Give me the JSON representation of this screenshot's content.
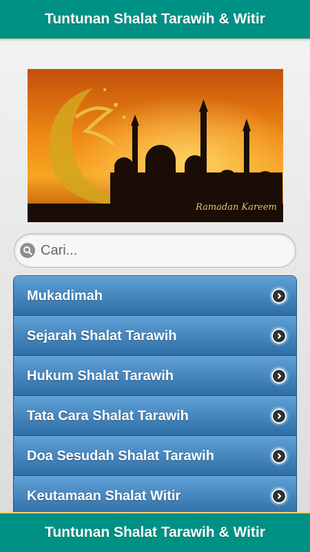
{
  "app": {
    "title": "Tuntunan Shalat Tarawih & Witir",
    "footer_title": "Tuntunan Shalat Tarawih & Witir"
  },
  "banner": {
    "caption": "Ramadan Kareem"
  },
  "search": {
    "placeholder": "Cari...",
    "value": ""
  },
  "menu": {
    "items": [
      {
        "label": "Mukadimah"
      },
      {
        "label": "Sejarah Shalat Tarawih"
      },
      {
        "label": "Hukum Shalat Tarawih"
      },
      {
        "label": "Tata Cara Shalat Tarawih"
      },
      {
        "label": "Doa Sesudah Shalat Tarawih"
      },
      {
        "label": "Keutamaan Shalat Witir"
      }
    ]
  },
  "colors": {
    "header_bg": "#009185",
    "menu_item_top": "#5e9fd4",
    "menu_item_bottom": "#2e6ea7"
  }
}
